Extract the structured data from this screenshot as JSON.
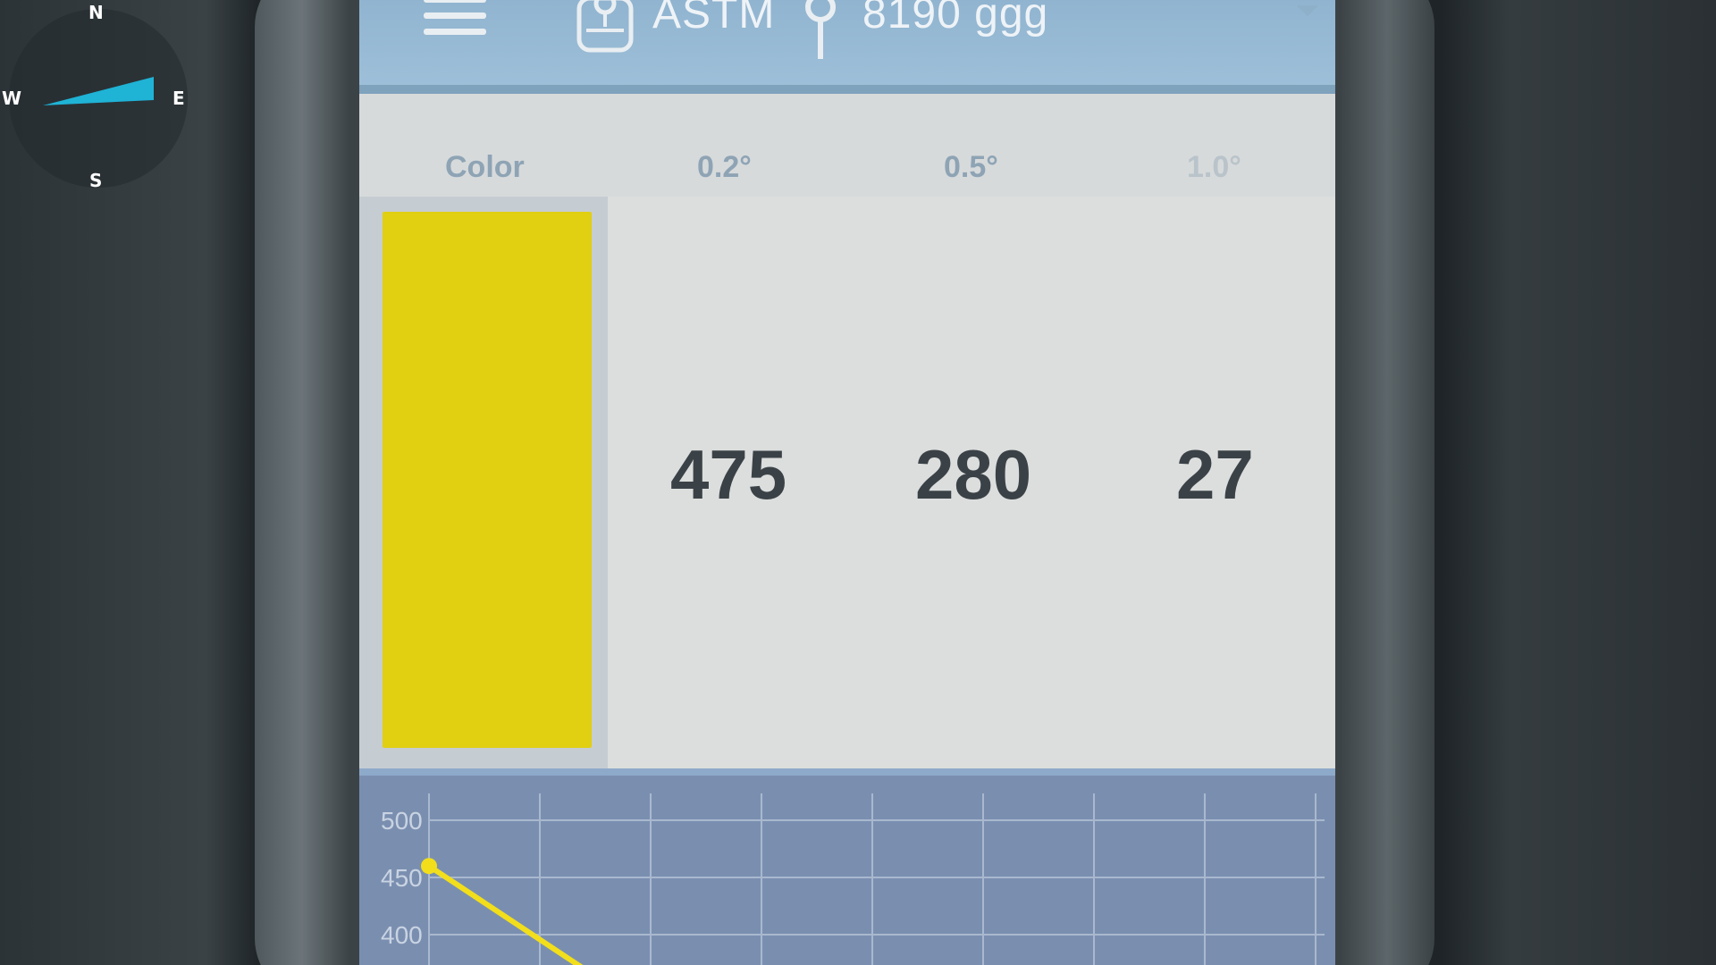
{
  "compass": {
    "north": "N",
    "east": "E",
    "south": "S",
    "west": "W",
    "needle_color": "#1fb3d6"
  },
  "topbar": {
    "menu_icon": "hamburger-menu-icon",
    "device_icon": "device-icon",
    "standard": "ASTM",
    "probe_icon": "probe-icon",
    "sample": "8190 ggg",
    "dropdown_icon": "chevron-down-icon",
    "background": "#9fc0d9"
  },
  "table": {
    "headers": {
      "color": "Color",
      "angle_1": "0.2°",
      "angle_2": "0.5°",
      "angle_3": "1.0°"
    },
    "swatch_color": "#e1cf12",
    "values": {
      "angle_1": "475",
      "angle_2": "280",
      "angle_3": "27"
    }
  },
  "chart_data": {
    "type": "line",
    "y_ticks": [
      "500",
      "450",
      "400"
    ],
    "ylim": [
      380,
      500
    ],
    "grid": true,
    "series": [
      {
        "values": [
          {
            "x": 0,
            "y": 460
          },
          {
            "x": 1.4,
            "y": 370
          }
        ]
      }
    ],
    "line_color": "#f2de1b"
  }
}
